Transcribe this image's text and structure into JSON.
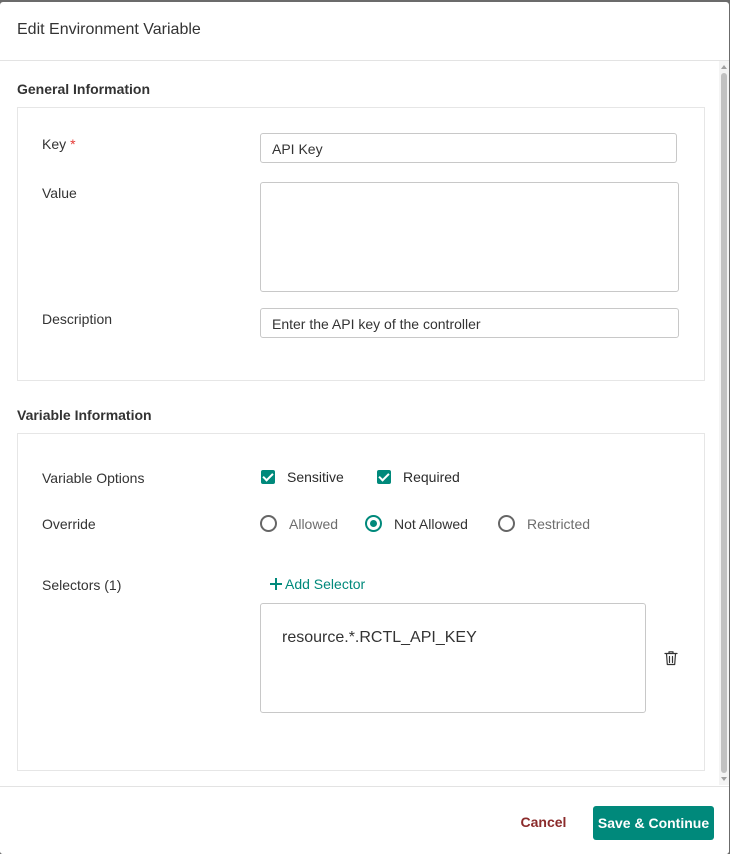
{
  "dialog": {
    "title": "Edit Environment Variable"
  },
  "general": {
    "title": "General Information",
    "key_label": "Key",
    "required_mark": "*",
    "key_value": "API Key",
    "value_label": "Value",
    "value_value": "",
    "description_label": "Description",
    "description_value": "Enter the API key of the controller"
  },
  "variable": {
    "title": "Variable Information",
    "options_label": "Variable Options",
    "options": [
      {
        "label": "Sensitive",
        "checked": true
      },
      {
        "label": "Required",
        "checked": true
      }
    ],
    "override_label": "Override",
    "override_options": [
      {
        "label": "Allowed",
        "selected": false
      },
      {
        "label": "Not Allowed",
        "selected": true
      },
      {
        "label": "Restricted",
        "selected": false
      }
    ],
    "selectors_label": "Selectors (1)",
    "add_selector_label": "Add Selector",
    "selectors": [
      "resource.*.RCTL_API_KEY"
    ]
  },
  "footer": {
    "cancel_label": "Cancel",
    "save_label": "Save & Continue"
  },
  "colors": {
    "accent": "#00897b",
    "cancel": "#8b2b2b",
    "required": "#e53935"
  },
  "icons": {
    "add": "plus-icon",
    "delete": "trash-icon",
    "check": "checkbox-checked-icon",
    "radio": "radio-icon"
  }
}
